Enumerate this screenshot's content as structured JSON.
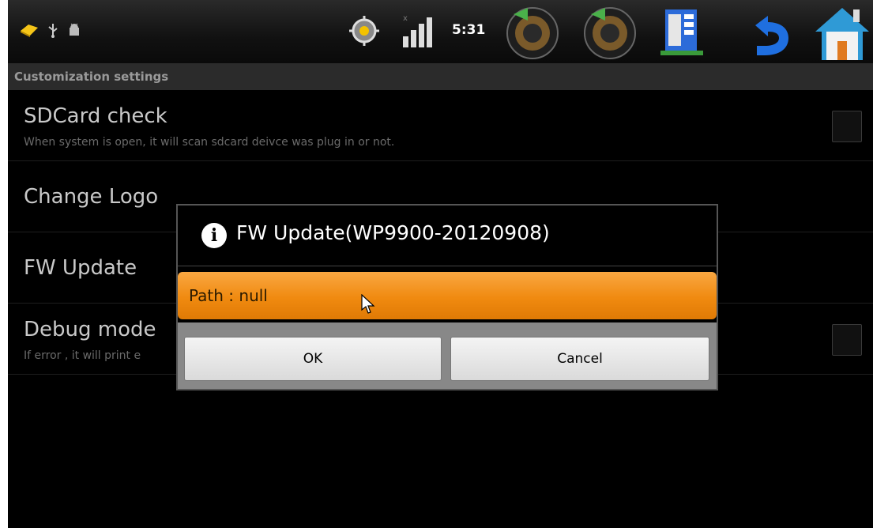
{
  "status_bar": {
    "time": "5:31",
    "icons": [
      "notification-icon",
      "usb-icon",
      "android-debug-icon",
      "gps-icon",
      "signal-icon",
      "volume-down-icon",
      "volume-up-icon",
      "menu-icon",
      "back-icon",
      "home-icon"
    ]
  },
  "settings": {
    "section_title": "Customization settings",
    "items": [
      {
        "title": "SDCard check",
        "summary": "When system is open, it will scan sdcard deivce was plug in or not."
      },
      {
        "title": "Change Logo",
        "summary": ""
      },
      {
        "title": "FW Update",
        "summary": ""
      },
      {
        "title": "Debug mode",
        "summary": "If error , it will print e"
      }
    ]
  },
  "dialog": {
    "title": "FW Update(WP9900-20120908)",
    "path": "Path : null",
    "ok_label": "OK",
    "cancel_label": "Cancel"
  },
  "colors": {
    "accent": "#f08a10",
    "background": "#000000"
  }
}
